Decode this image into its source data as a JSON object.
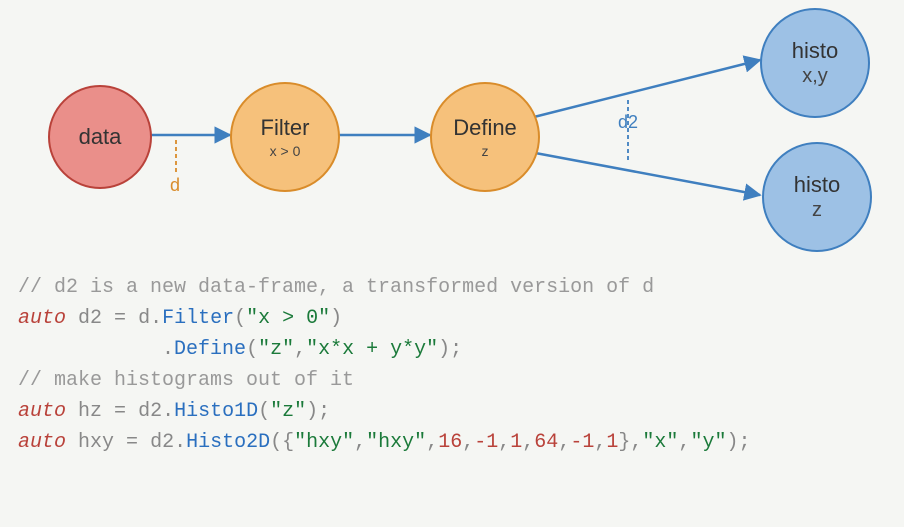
{
  "diagram": {
    "nodes": {
      "data": {
        "title": "data",
        "sub": ""
      },
      "filter": {
        "title": "Filter",
        "sub": "x > 0"
      },
      "define": {
        "title": "Define",
        "sub": "z"
      },
      "histo_xy": {
        "title": "histo",
        "sub": "x,y"
      },
      "histo_z": {
        "title": "histo",
        "sub": "z"
      }
    },
    "edge_labels": {
      "d": "d",
      "d2": "d2"
    }
  },
  "code": {
    "c1": "// d2 is a new data-frame, a transformed version of d",
    "kw_auto": "auto",
    "var_d2": "d2",
    "eq": " = ",
    "var_d": "d",
    "dot": ".",
    "fn_filter": "Filter",
    "open": "(",
    "close": ")",
    "semi": ";",
    "str_xgt0": "\"x > 0\"",
    "fn_define": "Define",
    "str_z": "\"z\"",
    "comma": ",",
    "str_xx_yy": "\"x*x + y*y\"",
    "c2": "// make histograms out of it",
    "var_hz": "hz",
    "fn_histo1d": "Histo1D",
    "var_hxy": "hxy",
    "fn_histo2d": "Histo2D",
    "lbrace": "{",
    "rbrace": "}",
    "str_hxy1": "\"hxy\"",
    "str_hxy2": "\"hxy\"",
    "n16": "16",
    "nm1a": "-1",
    "n1a": "1",
    "n64": "64",
    "nm1b": "-1",
    "n1b": "1",
    "str_x": "\"x\"",
    "str_y": "\"y\"",
    "indent_define": "            "
  }
}
